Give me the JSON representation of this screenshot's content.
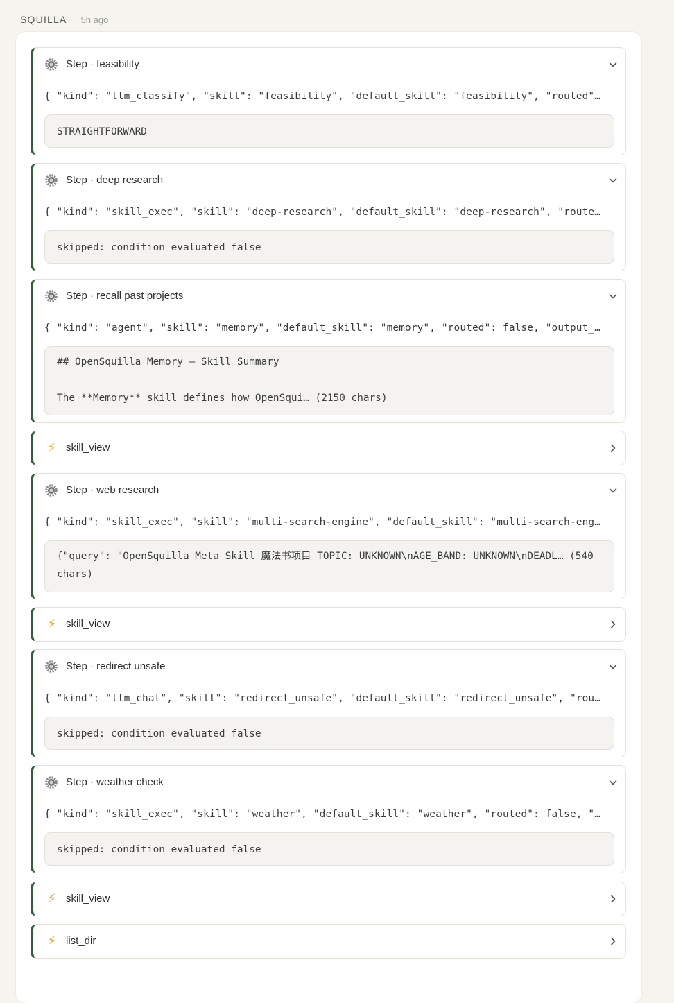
{
  "header": {
    "sender": "SQUILLA",
    "time": "5h ago"
  },
  "cards": [
    {
      "type": "step",
      "title": "Step · feasibility",
      "json": "{ \"kind\": \"llm_classify\", \"skill\": \"feasibility\", \"default_skill\": \"feasibility\", \"routed\"…",
      "output": "STRAIGHTFORWARD",
      "expanded": true
    },
    {
      "type": "step",
      "title": "Step · deep research",
      "json": "{ \"kind\": \"skill_exec\", \"skill\": \"deep-research\", \"default_skill\": \"deep-research\", \"route…",
      "output": "skipped: condition evaluated false",
      "expanded": true
    },
    {
      "type": "step",
      "title": "Step · recall past projects",
      "json": "{ \"kind\": \"agent\", \"skill\": \"memory\", \"default_skill\": \"memory\", \"routed\": false, \"output_…",
      "output": "## OpenSquilla Memory — Skill Summary\n\nThe **Memory** skill defines how OpenSqui… (2150 chars)",
      "expanded": true
    },
    {
      "type": "tool",
      "title": "skill_view",
      "icon": "bolt-icon"
    },
    {
      "type": "step",
      "title": "Step · web research",
      "json": "{ \"kind\": \"skill_exec\", \"skill\": \"multi-search-engine\", \"default_skill\": \"multi-search-eng…",
      "output": "{\"query\": \"OpenSquilla Meta Skill 魔法书项目 TOPIC: UNKNOWN\\nAGE_BAND: UNKNOWN\\nDEADL… (540 chars)",
      "expanded": true
    },
    {
      "type": "tool",
      "title": "skill_view",
      "icon": "bolt-icon"
    },
    {
      "type": "step",
      "title": "Step · redirect unsafe",
      "json": "{ \"kind\": \"llm_chat\", \"skill\": \"redirect_unsafe\", \"default_skill\": \"redirect_unsafe\", \"rou…",
      "output": "skipped: condition evaluated false",
      "expanded": true
    },
    {
      "type": "step",
      "title": "Step · weather check",
      "json": "{ \"kind\": \"skill_exec\", \"skill\": \"weather\", \"default_skill\": \"weather\", \"routed\": false, \"…",
      "output": "skipped: condition evaluated false",
      "expanded": true
    },
    {
      "type": "tool",
      "title": "skill_view",
      "icon": "bolt-icon"
    },
    {
      "type": "tool",
      "title": "list_dir",
      "icon": "bolt-icon"
    }
  ]
}
